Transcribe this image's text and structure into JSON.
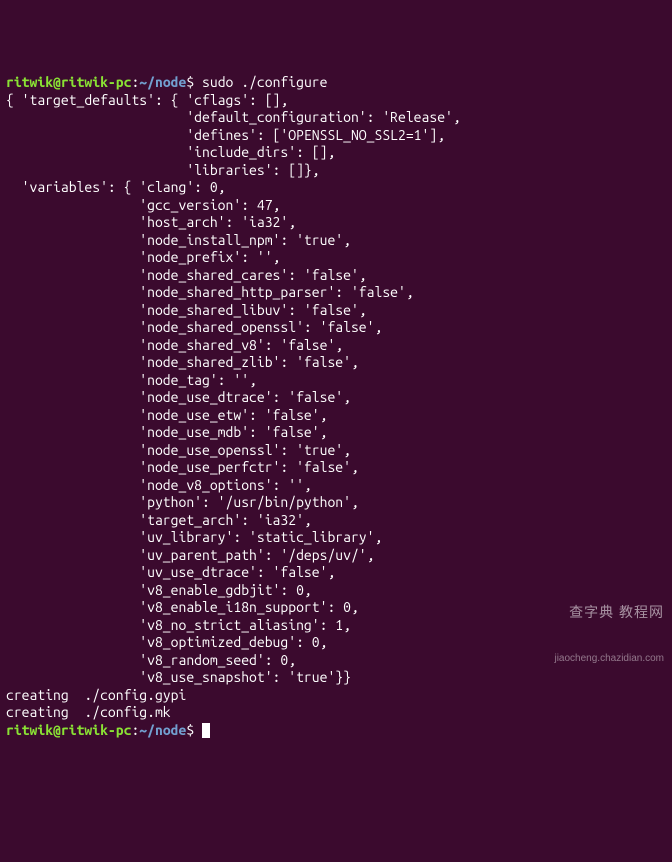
{
  "prompt": {
    "user_host": "ritwik@ritwik-pc",
    "separator": ":",
    "path": "~/node",
    "symbol": "$"
  },
  "command": "sudo ./configure",
  "output_lines": [
    "{ 'target_defaults': { 'cflags': [],",
    "                       'default_configuration': 'Release',",
    "                       'defines': ['OPENSSL_NO_SSL2=1'],",
    "                       'include_dirs': [],",
    "                       'libraries': []},",
    "  'variables': { 'clang': 0,",
    "                 'gcc_version': 47,",
    "                 'host_arch': 'ia32',",
    "                 'node_install_npm': 'true',",
    "                 'node_prefix': '',",
    "                 'node_shared_cares': 'false',",
    "                 'node_shared_http_parser': 'false',",
    "                 'node_shared_libuv': 'false',",
    "                 'node_shared_openssl': 'false',",
    "                 'node_shared_v8': 'false',",
    "                 'node_shared_zlib': 'false',",
    "                 'node_tag': '',",
    "                 'node_use_dtrace': 'false',",
    "                 'node_use_etw': 'false',",
    "                 'node_use_mdb': 'false',",
    "                 'node_use_openssl': 'true',",
    "                 'node_use_perfctr': 'false',",
    "                 'node_v8_options': '',",
    "                 'python': '/usr/bin/python',",
    "                 'target_arch': 'ia32',",
    "                 'uv_library': 'static_library',",
    "                 'uv_parent_path': '/deps/uv/',",
    "                 'uv_use_dtrace': 'false',",
    "                 'v8_enable_gdbjit': 0,",
    "                 'v8_enable_i18n_support': 0,",
    "                 'v8_no_strict_aliasing': 1,",
    "                 'v8_optimized_debug': 0,",
    "                 'v8_random_seed': 0,",
    "                 'v8_use_snapshot': 'true'}}",
    "creating  ./config.gypi",
    "creating  ./config.mk"
  ],
  "watermark": {
    "line1": "查字典 教程网",
    "line2": "jiaocheng.chazidian.com"
  }
}
